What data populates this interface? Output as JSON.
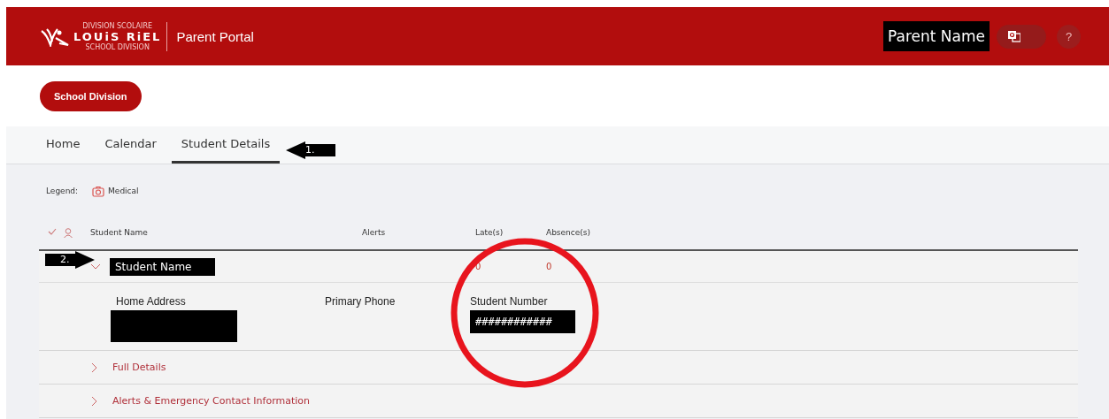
{
  "header": {
    "logo": {
      "top_line": "DIVISION SCOLAIRE",
      "name": "LOUiS RiEL",
      "bottom_line": "SCHOOL DIVISION"
    },
    "title": "Parent Portal",
    "user": "Parent Name",
    "help": "?"
  },
  "school_button": "School Division",
  "tabs": [
    {
      "label": "Home",
      "selected": false
    },
    {
      "label": "Calendar",
      "selected": false
    },
    {
      "label": "Student Details",
      "selected": true
    }
  ],
  "legend": {
    "label": "Legend:",
    "items": [
      "Medical"
    ]
  },
  "table": {
    "columns": [
      "Student Name",
      "Alerts",
      "Late(s)",
      "Absence(s)"
    ],
    "rows": [
      {
        "name": "Student Name",
        "expanded": true,
        "lates": "0",
        "absences": "0",
        "details": [
          {
            "label": "Home Address",
            "redacted": true
          },
          {
            "label": "Primary Phone",
            "redacted": false
          },
          {
            "label": "Student Number",
            "value": "############",
            "redacted": true
          }
        ],
        "sections": [
          {
            "label": "Full Details",
            "expanded": false
          },
          {
            "label": "Alerts & Emergency Contact Information",
            "expanded": false
          }
        ]
      }
    ]
  },
  "annotations": {
    "arrows": [
      {
        "label": "1.",
        "kind": "left"
      },
      {
        "label": "2.",
        "kind": "right"
      }
    ],
    "circle": true
  }
}
